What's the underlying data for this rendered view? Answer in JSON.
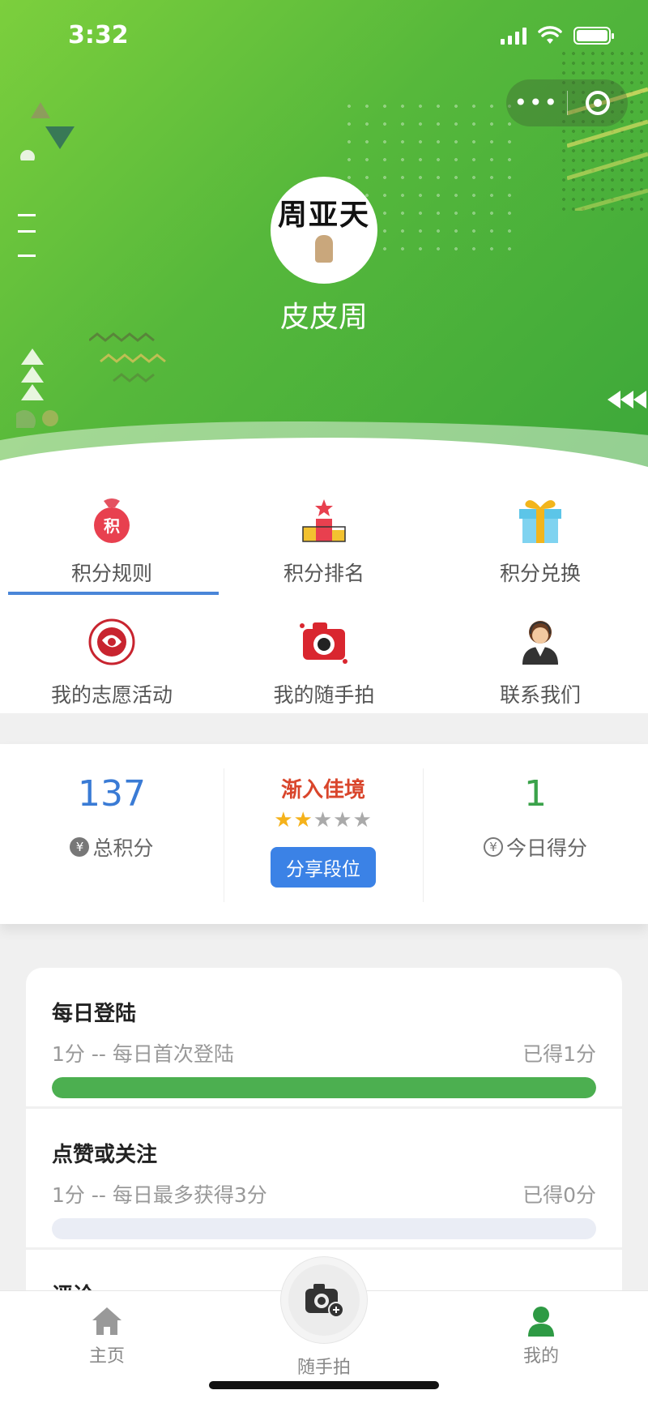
{
  "status_bar": {
    "time": "3:32"
  },
  "profile": {
    "avatar_text": "周亚天",
    "username": "皮皮周"
  },
  "menu": {
    "items": [
      {
        "label": "积分规则",
        "icon": "points-bag-icon"
      },
      {
        "label": "积分排名",
        "icon": "podium-icon"
      },
      {
        "label": "积分兑换",
        "icon": "gift-icon"
      },
      {
        "label": "我的志愿活动",
        "icon": "volunteer-emblem-icon"
      },
      {
        "label": "我的随手拍",
        "icon": "camera-icon"
      },
      {
        "label": "联系我们",
        "icon": "support-agent-icon"
      }
    ],
    "active_index": 0
  },
  "stats": {
    "total_points": "137",
    "total_points_label": "总积分",
    "level_name": "渐入佳境",
    "level_stars": 2,
    "level_stars_max": 5,
    "share_label": "分享段位",
    "today_points": "1",
    "today_points_label": "今日得分",
    "yen_symbol": "¥"
  },
  "tasks": [
    {
      "title": "每日登陆",
      "desc": "1分 -- 每日首次登陆",
      "earned": "已得1分",
      "progress": 1.0
    },
    {
      "title": "点赞或关注",
      "desc": "1分 -- 每日最多获得3分",
      "earned": "已得0分",
      "progress": 0.0
    },
    {
      "title": "评论"
    }
  ],
  "tabbar": {
    "home": "主页",
    "snap": "随手拍",
    "mine": "我的"
  },
  "colors": {
    "header_green": "#56b83b",
    "accent_blue": "#3b82e6",
    "points_blue": "#3a7bd5",
    "today_green": "#3aa24a",
    "level_red": "#d9452b",
    "star_gold": "#f5b21b",
    "star_grey": "#aaaaaa",
    "progress_green": "#4caf50",
    "tab_active": "#2e9a44"
  }
}
